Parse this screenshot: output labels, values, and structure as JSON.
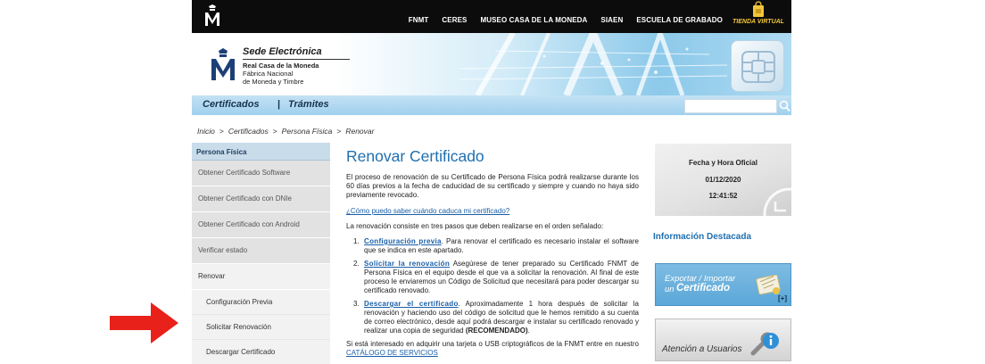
{
  "topbar": {
    "logo_letter": "M",
    "nav": [
      "FNMT",
      "CERES",
      "MUSEO CASA DE LA MONEDA",
      "SIAEN",
      "ESCUELA DE GRABADO"
    ],
    "tienda_label": "TIENDA VIRTUAL"
  },
  "banner": {
    "sede": "Sede Electrónica",
    "org_line1": "Real Casa de la Moneda",
    "org_line2": "Fábrica Nacional",
    "org_line3": "de Moneda y Timbre"
  },
  "bluenav": {
    "certificados": "Certificados",
    "separator": "|",
    "tramites": "Trámites",
    "search_value": ""
  },
  "breadcrumb": {
    "items": [
      "Inicio",
      "Certificados",
      "Persona Física",
      "Renovar"
    ],
    "separator": ">"
  },
  "sidebar": {
    "heading": "Persona Física",
    "items": [
      "Obtener Certificado Software",
      "Obtener Certificado con DNIe",
      "Obtener Certificado con Android",
      "Verificar estado",
      "Renovar"
    ],
    "sub_items": [
      "Configuración Previa",
      "Solicitar Renovación",
      "Descargar Certificado"
    ]
  },
  "main": {
    "title": "Renovar Certificado",
    "intro": "El proceso de renovación de su Certificado de Persona Física podrá realizarse durante los 60 días previos a la fecha de caducidad de su certificado y siempre y cuando no haya sido previamente revocado.",
    "question_link": "¿Cómo puedo saber cuándo caduca mi certificado?",
    "steps_intro": "La renovación consiste en tres pasos que deben realizarse en el orden señalado:",
    "steps": [
      {
        "num": "1.",
        "link": "Configuración previa",
        "text": ". Para renovar el certificado es necesario instalar el software que se indica en este apartado."
      },
      {
        "num": "2.",
        "link": "Solicitar la renovación",
        "text": " Asegúrese de tener preparado su Certificado FNMT de Persona Física en el equipo desde el que va a solicitar la renovación. Al final de este proceso le enviaremos un Código de Solicitud que necesitará para poder descargar su certificado renovado."
      },
      {
        "num": "3.",
        "link": "Descargar el certificado",
        "text": ". Aproximadamente 1 hora después de solicitar la renovación y haciendo uso del código de solicitud que le hemos remitido a su cuenta de correo electrónico, desde aquí podrá descargar e instalar su certificado renovado y realizar una copia de seguridad ",
        "bold": "(RECOMENDADO)",
        "tail": "."
      }
    ],
    "outro_text": "Si está interesado en adquirir una tarjeta o USB criptográficos de la FNMT entre en nuestro ",
    "outro_link": "CATÁLOGO DE SERVICIOS"
  },
  "right": {
    "clock_label": "Fecha y Hora Oficial",
    "date": "01/12/2020",
    "time": "12:41:52",
    "info_title": "Información Destacada",
    "export_line1": "Exportar / Importar",
    "export_line2a": "un",
    "export_line2b": "Certificado",
    "export_more": "[+]",
    "attention": "Atención a Usuarios"
  },
  "colors": {
    "accent_blue": "#1f6fb0",
    "link_blue": "#1a5fa8",
    "arrow_red": "#e8211a",
    "topbar_black": "#0c0c0c"
  }
}
